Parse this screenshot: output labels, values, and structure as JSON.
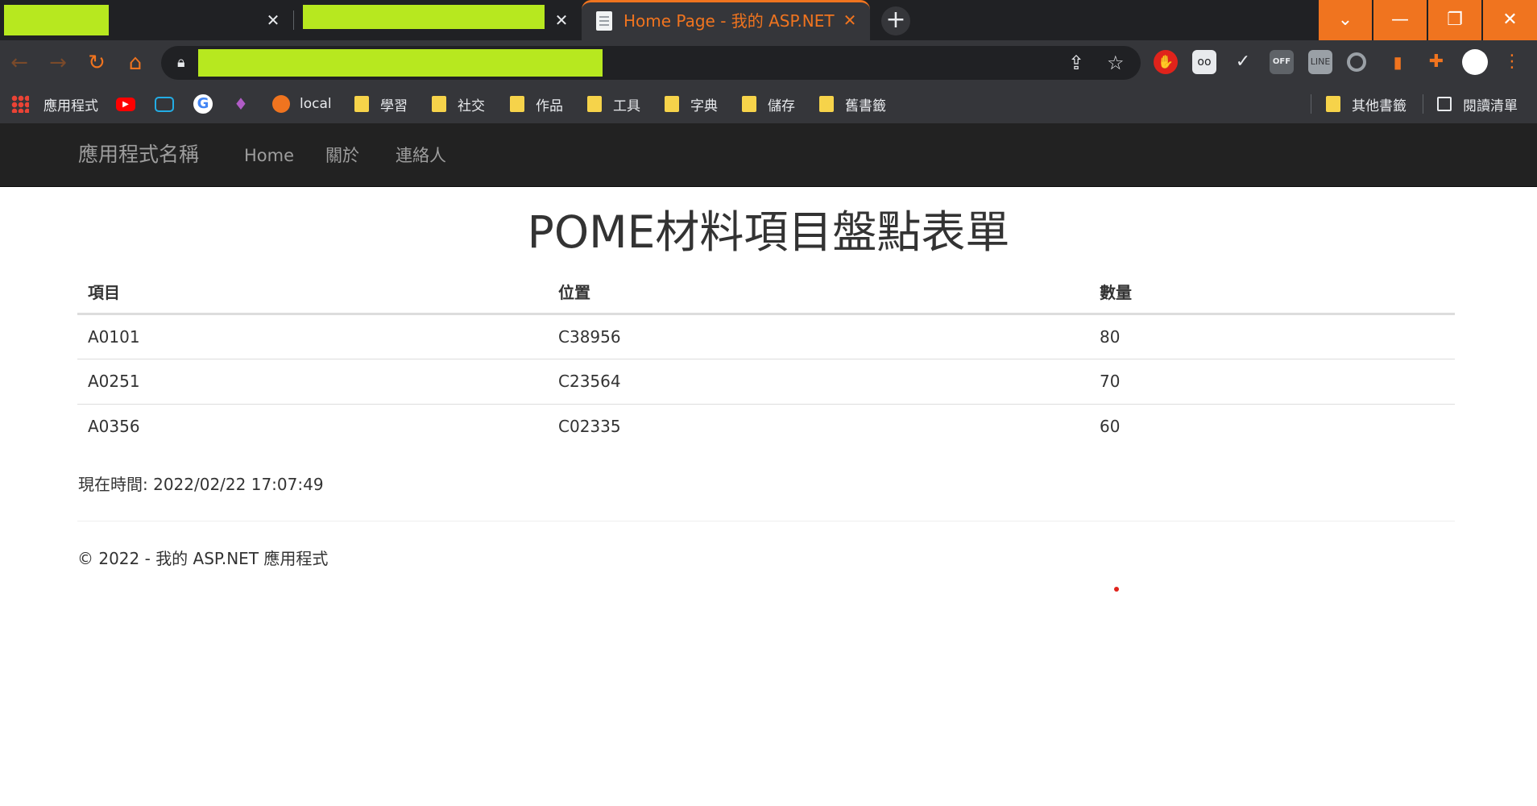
{
  "browser": {
    "tabs": [
      {
        "title": "",
        "redacted": true
      },
      {
        "title": "",
        "redacted": true
      },
      {
        "title": "Home Page - 我的 ASP.NET 應用程式",
        "active": true
      }
    ],
    "new_tab_label": "+",
    "window_controls": {
      "list": "⌄",
      "minimize": "—",
      "restore": "❐",
      "close": "✕"
    },
    "address_bar": {
      "url": "",
      "redacted": true
    },
    "accent_color": "#f0741f",
    "bookmarks": [
      {
        "label": "應用程式",
        "icon": "apps-grid-icon"
      },
      {
        "label": "",
        "icon": "youtube-icon"
      },
      {
        "label": "",
        "icon": "bilibili-icon"
      },
      {
        "label": "",
        "icon": "google-icon"
      },
      {
        "label": "",
        "icon": "gem-icon"
      },
      {
        "label": "local",
        "icon": "globe-icon"
      },
      {
        "label": "學習",
        "icon": "folder-icon"
      },
      {
        "label": "社交",
        "icon": "folder-icon"
      },
      {
        "label": "作品",
        "icon": "folder-icon"
      },
      {
        "label": "工具",
        "icon": "folder-icon"
      },
      {
        "label": "字典",
        "icon": "folder-icon"
      },
      {
        "label": "儲存",
        "icon": "folder-icon"
      },
      {
        "label": "舊書籤",
        "icon": "folder-icon"
      },
      {
        "label": "其他書籤",
        "icon": "folder-icon"
      },
      {
        "label": "閱讀清單",
        "icon": "reading-list-icon"
      }
    ]
  },
  "site": {
    "brand": "應用程式名稱",
    "nav": [
      "Home",
      "關於",
      "連絡人"
    ],
    "title": "POME材料項目盤點表單",
    "table": {
      "headers": [
        "項目",
        "位置",
        "數量"
      ],
      "rows": [
        [
          "A0101",
          "C38956",
          "80"
        ],
        [
          "A0251",
          "C23564",
          "70"
        ],
        [
          "A0356",
          "C02335",
          "60"
        ]
      ]
    },
    "now_text": "現在時間: 2022/02/22 17:07:49",
    "footer": "© 2022 - 我的 ASP.NET 應用程式"
  }
}
